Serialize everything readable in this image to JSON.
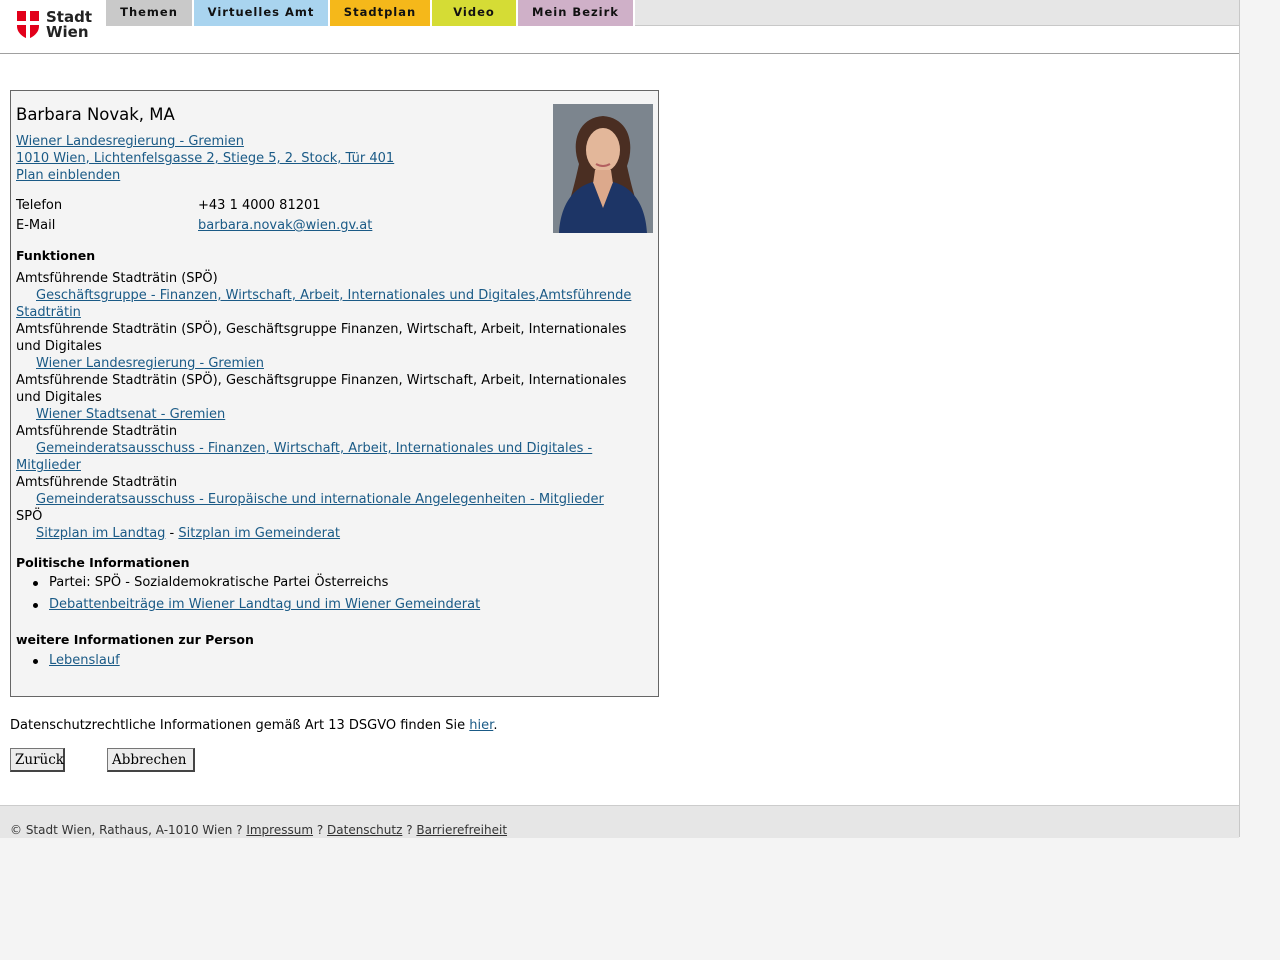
{
  "header": {
    "logo": {
      "line1": "Stadt",
      "line2": "Wien",
      "icon": "vienna-coat-of-arms-icon"
    },
    "nav": [
      {
        "label": "Themen",
        "color": "#c9c9c9"
      },
      {
        "label": "Virtuelles Amt",
        "color": "#a9d4ef"
      },
      {
        "label": "Stadtplan",
        "color": "#f5b81a"
      },
      {
        "label": "Video",
        "color": "#d5dc35"
      },
      {
        "label": "Mein Bezirk",
        "color": "#cfb0c8"
      }
    ]
  },
  "person": {
    "name": "Barbara Novak, MA",
    "org_link": "Wiener Landesregierung - Gremien ",
    "address_link": "1010 Wien, Lichtenfelsgasse 2, Stiege 5, 2. Stock, Tür 401",
    "plan_link": "Plan einblenden",
    "phone_label": "Telefon",
    "phone": "+43 1 4000 81201",
    "email_label": "E-Mail",
    "email": "barbara.novak@wien.gv.at"
  },
  "functions": {
    "heading": "Funktionen",
    "items": [
      {
        "text": "Amtsführende Stadträtin (SPÖ)",
        "link": "Geschäftsgruppe - Finanzen, Wirtschaft, Arbeit, Internationales und Digitales,Amtsführende Stadträtin"
      },
      {
        "text": "Amtsführende Stadträtin (SPÖ), Geschäftsgruppe Finanzen, Wirtschaft, Arbeit, Internationales und Digitales",
        "link": "Wiener Landesregierung - Gremien"
      },
      {
        "text": "Amtsführende Stadträtin (SPÖ), Geschäftsgruppe Finanzen, Wirtschaft, Arbeit, Internationales und Digitales",
        "link": "Wiener Stadtsenat - Gremien"
      },
      {
        "text": "Amtsführende Stadträtin",
        "link": "Gemeinderatsausschuss - Finanzen, Wirtschaft, Arbeit, Internationales und Digitales - Mitglieder"
      },
      {
        "text": "Amtsführende Stadträtin",
        "link": "Gemeinderatsausschuss - Europäische und internationale Angelegenheiten - Mitglieder"
      }
    ],
    "party": "SPÖ",
    "seat_landtag": "Sitzplan im Landtag",
    "seat_separator": " - ",
    "seat_gemeinderat": "Sitzplan im Gemeinderat"
  },
  "political": {
    "heading": "Politische Informationen",
    "party_text": "Partei: SPÖ - Sozialdemokratische Partei Österreichs",
    "debates_link": "Debattenbeiträge im Wiener Landtag und im Wiener Gemeinderat"
  },
  "more": {
    "heading": "weitere Informationen zur Person",
    "cv_link": "Lebenslauf"
  },
  "dsgvo": {
    "text": "Datenschutzrechtliche Informationen gemäß Art 13 DSGVO finden Sie ",
    "link": "hier",
    "end": "."
  },
  "buttons": {
    "back": "Zurück",
    "cancel": "Abbrechen"
  },
  "footer": {
    "copyright": "© Stadt Wien, Rathaus, A-1010 Wien",
    "sep": " ? ",
    "impressum": "Impressum",
    "datenschutz": "Datenschutz",
    "barrierefreiheit": "Barrierefreiheit"
  },
  "colors": {
    "link": "#1a5a86",
    "logo_red": "#e2001a"
  }
}
